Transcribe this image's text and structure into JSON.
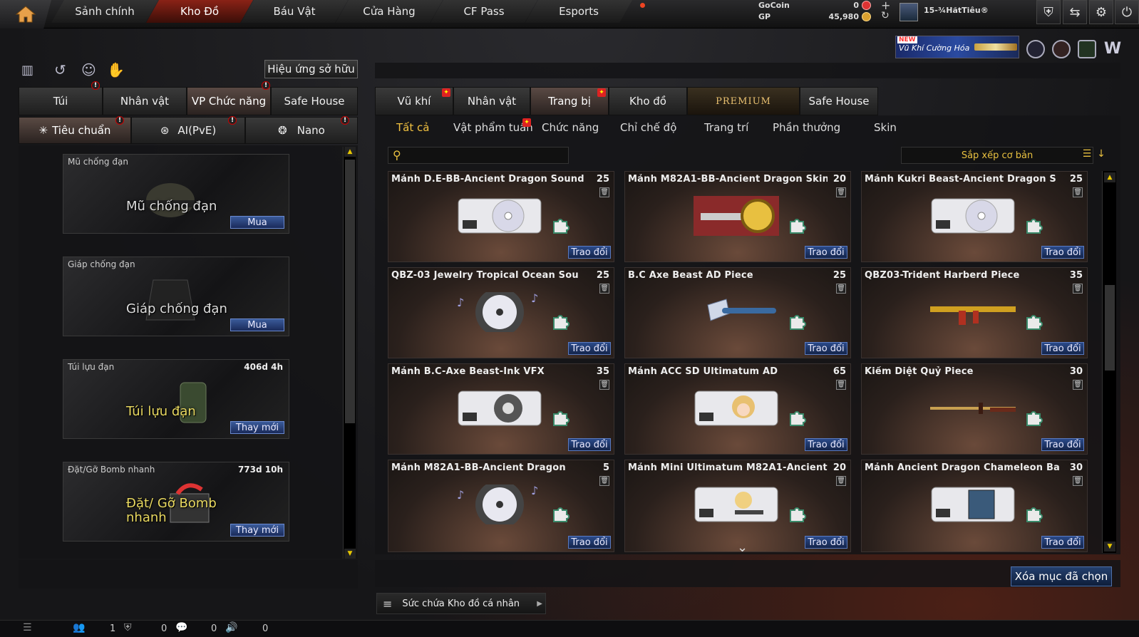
{
  "nav": {
    "tabs": [
      "Sảnh chính",
      "Kho Đồ",
      "Báu Vật",
      "Cửa Hàng",
      "CF Pass",
      "Esports"
    ],
    "active": 1,
    "gocoin_label": "GoCoin",
    "gocoin_value": "0",
    "gp_label": "GP",
    "gp_value": "45,980",
    "player_name": "15-¾HătTiêu®"
  },
  "promo": {
    "badge": "NEW",
    "text": "Vũ Khí Cường Hóa"
  },
  "left": {
    "effect_button": "Hiệu ứng sở hữu",
    "tabs": [
      "Túi",
      "Nhân vật",
      "VP Chức năng",
      "Safe House"
    ],
    "active_tab": 2,
    "subtabs": [
      "Tiêu chuẩn",
      "AI(PvE)",
      "Nano"
    ],
    "active_subtab": 0,
    "items": [
      {
        "title": "Mũ chống đạn",
        "time": "",
        "big": "Mũ chống đạn",
        "button": "Mua"
      },
      {
        "title": "Giáp chống đạn",
        "time": "",
        "big": "Giáp chống đạn",
        "button": "Mua"
      },
      {
        "title": "Túi lựu đạn",
        "time": "406d 4h",
        "big": "Túi lựu đạn",
        "button": "Thay mới"
      },
      {
        "title": "Đặt/Gỡ Bomb nhanh",
        "time": "773d 10h",
        "big": "Đặt/ Gỡ Bomb nhanh",
        "button": "Thay mới"
      }
    ]
  },
  "right": {
    "tabs": [
      "Vũ khí",
      "Nhân vật",
      "Trang bị",
      "Kho đồ",
      "PREMIUM",
      "Safe House"
    ],
    "active_tab": 2,
    "subtabs": [
      "Tất cả",
      "Vật phẩm tuần",
      "Chức năng",
      "Chỉ chế độ",
      "Trang trí",
      "Phần thưởng",
      "Skin"
    ],
    "active_subtab": 0,
    "search_placeholder": "",
    "sort_label": "Sắp xếp cơ bản",
    "trade_label": "Trao đổi",
    "items": [
      {
        "name": "Mảnh D.E-BB-Ancient Dragon Sound",
        "qty": "25",
        "art": "disc-ticket"
      },
      {
        "name": "Mảnh M82A1-BB-Ancient Dragon Skin",
        "qty": "20",
        "art": "gun-gold"
      },
      {
        "name": "Mảnh Kukri Beast-Ancient Dragon S",
        "qty": "25",
        "art": "disc-ticket"
      },
      {
        "name": "QBZ-03 Jewelry Tropical Ocean Sou",
        "qty": "25",
        "art": "music-disc"
      },
      {
        "name": "B.C Axe Beast AD Piece",
        "qty": "25",
        "art": "axe"
      },
      {
        "name": "QBZ03-Trident Harberd Piece",
        "qty": "35",
        "art": "rifle"
      },
      {
        "name": "Mảnh B.C-Axe Beast-Ink VFX",
        "qty": "35",
        "art": "vfx-ticket"
      },
      {
        "name": "Mảnh ACC SD Ultimatum AD",
        "qty": "65",
        "art": "char-ticket"
      },
      {
        "name": "Kiếm Diệt Quỷ Piece",
        "qty": "30",
        "art": "sword"
      },
      {
        "name": "Mảnh M82A1-BB-Ancient Dragon",
        "qty": "5",
        "art": "music-disc"
      },
      {
        "name": "Mảnh Mini Ultimatum M82A1-Ancient",
        "qty": "20",
        "art": "char-ticket2"
      },
      {
        "name": "Mảnh Ancient Dragon Chameleon Ba",
        "qty": "30",
        "art": "box-ticket"
      }
    ],
    "delete_button": "Xóa mục đã chọn",
    "capacity_label": "Sức chứa Kho đồ cá nhân"
  },
  "statusbar": {
    "v1": "1",
    "v2": "0",
    "v3": "0",
    "v4": "0"
  }
}
